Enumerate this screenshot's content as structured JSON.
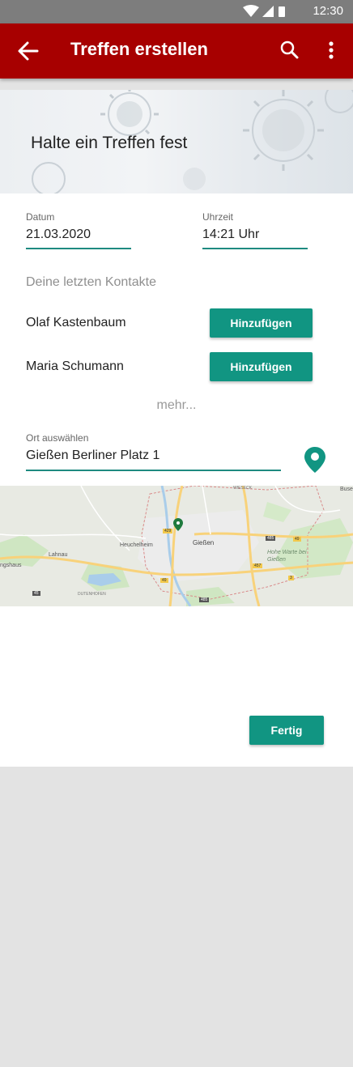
{
  "status_bar": {
    "time": "12:30"
  },
  "app_bar": {
    "title": "Treffen erstellen"
  },
  "hero": {
    "title": "Halte ein Treffen fest"
  },
  "date": {
    "label": "Datum",
    "value": "21.03.2020"
  },
  "time": {
    "label": "Uhrzeit",
    "value": "14:21 Uhr"
  },
  "contacts": {
    "title": "Deine letzten Kontakte",
    "items": [
      {
        "name": "Olaf Kastenbaum",
        "button": "Hinzufügen"
      },
      {
        "name": "Maria Schumann",
        "button": "Hinzufügen"
      }
    ],
    "more": "mehr..."
  },
  "location": {
    "label": "Ort auswählen",
    "value": "Gießen Berliner Platz 1"
  },
  "map": {
    "labels": [
      "Gießen",
      "Heuchelheim",
      "Lahnau",
      "Hohe Warte bei Gießen",
      "WIESECK",
      "Buse",
      "DUTENHOFEN",
      "ngshaus"
    ],
    "road_numbers": [
      "429",
      "49",
      "485",
      "457",
      "49",
      "485",
      "45",
      "3"
    ]
  },
  "colors": {
    "accent": "#119582",
    "app_bar": "#a70000",
    "underline": "#1e8a80"
  },
  "footer": {
    "done_label": "Fertig"
  }
}
